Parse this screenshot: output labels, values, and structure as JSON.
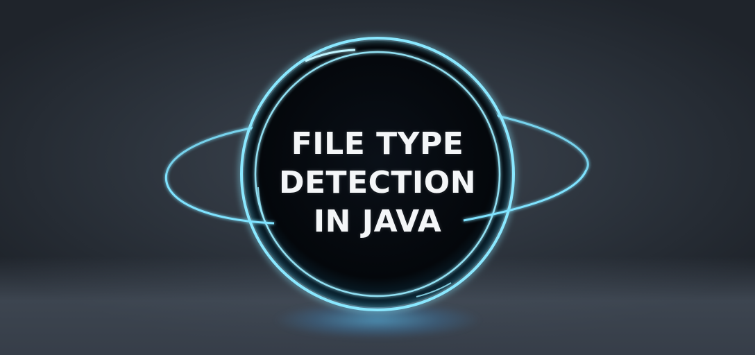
{
  "title": {
    "line1": "FILE TYPE",
    "line2": "DETECTION",
    "line3": "IN JAVA"
  },
  "colors": {
    "ring": "#7fe3ff",
    "ring_glow": "#3fb6ff",
    "disc": "#05080d",
    "background": "#2c333c",
    "text": "#f4f6f8"
  }
}
